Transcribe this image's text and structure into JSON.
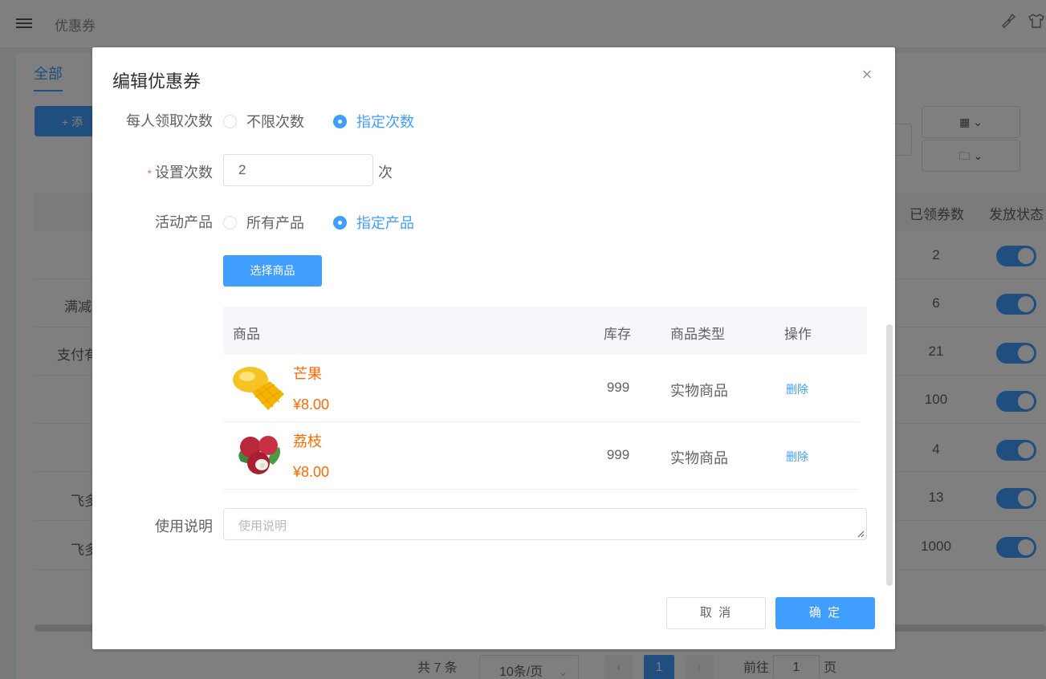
{
  "background": {
    "page_title": "优惠券",
    "tab_all": "全部",
    "add_button": "+ 添",
    "table_headers": {
      "received": "已领券数",
      "status": "发放状态"
    },
    "rows": [
      {
        "left": "",
        "count": "2"
      },
      {
        "left": "满减",
        "count": "6"
      },
      {
        "left": "支付有",
        "count": "21"
      },
      {
        "left": "",
        "count": "100"
      },
      {
        "left": "",
        "count": "4"
      },
      {
        "left": "飞多",
        "count": "13"
      },
      {
        "left": "飞多",
        "count": "1000"
      }
    ],
    "pagination": {
      "total": "共 7 条",
      "page_size": "10条/页",
      "current_page": "1",
      "goto_label": "前往",
      "goto_value": "1",
      "page_suffix": "页"
    }
  },
  "dialog": {
    "title": "编辑优惠券",
    "claim_limit": {
      "label": "每人领取次数",
      "options": [
        "不限次数",
        "指定次数"
      ],
      "selected": "指定次数"
    },
    "set_times": {
      "label": "设置次数",
      "value": "2",
      "unit": "次"
    },
    "products": {
      "label": "活动产品",
      "options": [
        "所有产品",
        "指定产品"
      ],
      "selected": "指定产品"
    },
    "select_button": "选择商品",
    "table": {
      "headers": [
        "商品",
        "库存",
        "商品类型",
        "操作"
      ],
      "rows": [
        {
          "name": "芒果",
          "price": "¥8.00",
          "stock": "999",
          "type": "实物商品",
          "action": "删除"
        },
        {
          "name": "荔枝",
          "price": "¥8.00",
          "stock": "999",
          "type": "实物商品",
          "action": "删除"
        }
      ]
    },
    "description": {
      "label": "使用说明",
      "placeholder": "使用说明"
    },
    "cancel_button": "取 消",
    "ok_button": "确 定"
  }
}
